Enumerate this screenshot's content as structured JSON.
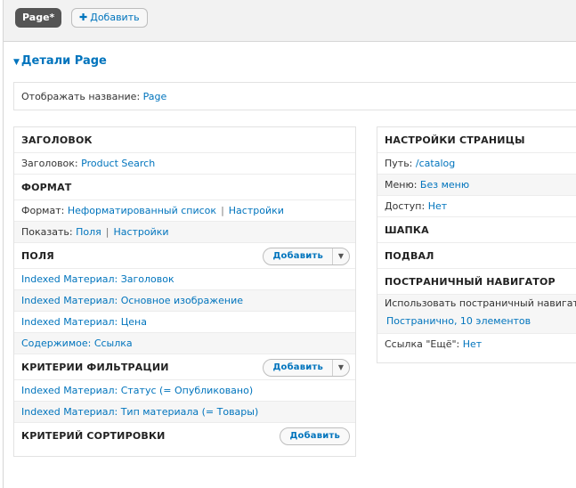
{
  "topbar": {
    "page_tab": "Page*",
    "add_label": "Добавить"
  },
  "details": {
    "title": "Детали Page",
    "display_name_label": "Отображать название:",
    "display_name_value": "Page"
  },
  "left": {
    "title_section": {
      "heading": "ЗАГОЛОВОК",
      "label": "Заголовок:",
      "value": "Product Search"
    },
    "format_section": {
      "heading": "ФОРМАТ",
      "format_label": "Формат:",
      "format_value": "Неформатированный список",
      "format_settings": "Настройки",
      "show_label": "Показать:",
      "show_value": "Поля",
      "show_settings": "Настройки"
    },
    "fields_section": {
      "heading": "ПОЛЯ",
      "add_label": "Добавить",
      "items": [
        "Indexed Материал: Заголовок",
        "Indexed Материал: Основное изображение",
        "Indexed Материал: Цена",
        "Содержимое: Ссылка"
      ]
    },
    "filter_section": {
      "heading": "КРИТЕРИИ ФИЛЬТРАЦИИ",
      "add_label": "Добавить",
      "items": [
        "Indexed Материал: Статус (= Опубликовано)",
        "Indexed Материал: Тип материала (= Товары)"
      ]
    },
    "sort_section": {
      "heading": "КРИТЕРИЙ СОРТИРОВКИ",
      "add_label": "Добавить"
    }
  },
  "right": {
    "page_settings": {
      "heading": "НАСТРОЙКИ СТРАНИЦЫ",
      "path_label": "Путь:",
      "path_value": "/catalog",
      "menu_label": "Меню:",
      "menu_value": "Без меню",
      "access_label": "Доступ:",
      "access_value": "Нет"
    },
    "header_heading": "ШАПКА",
    "footer_heading": "ПОДВАЛ",
    "pager": {
      "heading": "ПОСТРАНИЧНЫЙ НАВИГАТОР",
      "use_label": "Использовать постраничный навигатор",
      "use_value": "Постранично, 10 элементов",
      "more_label": "Ссылка \"Ещё\":",
      "more_value": "Нет"
    }
  }
}
